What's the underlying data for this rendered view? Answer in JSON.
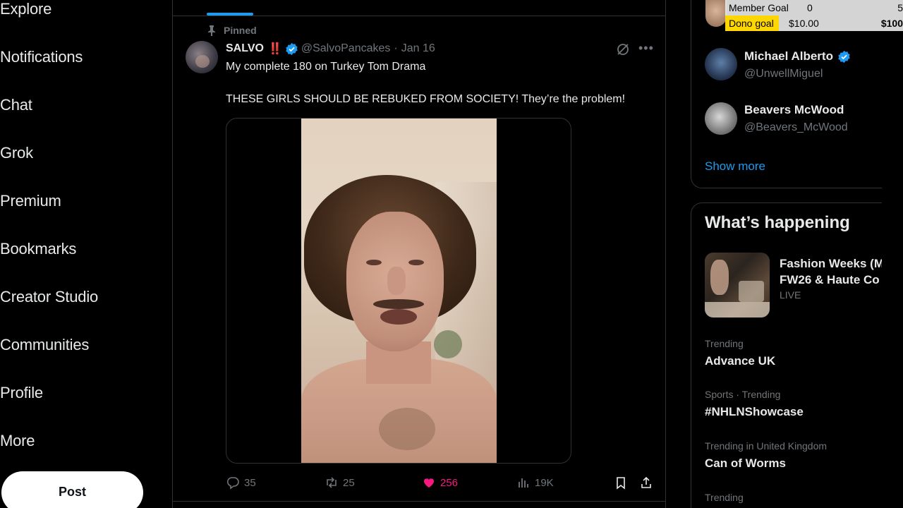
{
  "sidebar": {
    "items": [
      {
        "label": "Explore"
      },
      {
        "label": "Notifications"
      },
      {
        "label": "Chat"
      },
      {
        "label": "Grok"
      },
      {
        "label": "Premium"
      },
      {
        "label": "Bookmarks"
      },
      {
        "label": "Creator Studio"
      },
      {
        "label": "Communities"
      },
      {
        "label": "Profile"
      },
      {
        "label": "More"
      }
    ],
    "post_button": "Post"
  },
  "post": {
    "pinned_label": "Pinned",
    "author_name": "SALVO",
    "author_emoji": "‼️",
    "handle": "@SalvoPancakes",
    "separator": "·",
    "date": "Jan 16",
    "text_line1": "My complete 180 on Turkey Tom Drama",
    "text_line2": "THESE GIRLS SHOULD BE REBUKED FROM SOCIETY! They’re the problem!",
    "stats": {
      "replies": "35",
      "reposts": "25",
      "likes": "256",
      "views": "19K"
    },
    "colors": {
      "like_active": "#f91880",
      "verified": "#1d9bf0"
    }
  },
  "who_to_follow": {
    "users": [
      {
        "name": "Michael Alberto",
        "handle": "@UnwellMiguel",
        "verified": true
      },
      {
        "name": "Beavers McWood",
        "handle": "@Beavers_McWood",
        "verified": false
      }
    ],
    "show_more": "Show more"
  },
  "whats_happening": {
    "title": "What’s happening",
    "featured": {
      "title_line1": "Fashion Weeks (M",
      "title_line2": "FW26 & Haute Co",
      "status": "LIVE"
    },
    "trends": [
      {
        "context": "Trending",
        "name": "Advance UK"
      },
      {
        "context": "Sports · Trending",
        "name": "#NHLNShowcase"
      },
      {
        "context": "Trending in United Kingdom",
        "name": "Can of Worms"
      },
      {
        "context": "Trending",
        "name": ""
      }
    ]
  },
  "stream_overlay": {
    "member_goal": {
      "label": "Member Goal",
      "current": "0",
      "target": "5"
    },
    "dono_goal": {
      "label": "Dono goal",
      "current": "$10.00",
      "target": "$100"
    },
    "colors": {
      "dono_highlight": "#ffd700"
    }
  }
}
